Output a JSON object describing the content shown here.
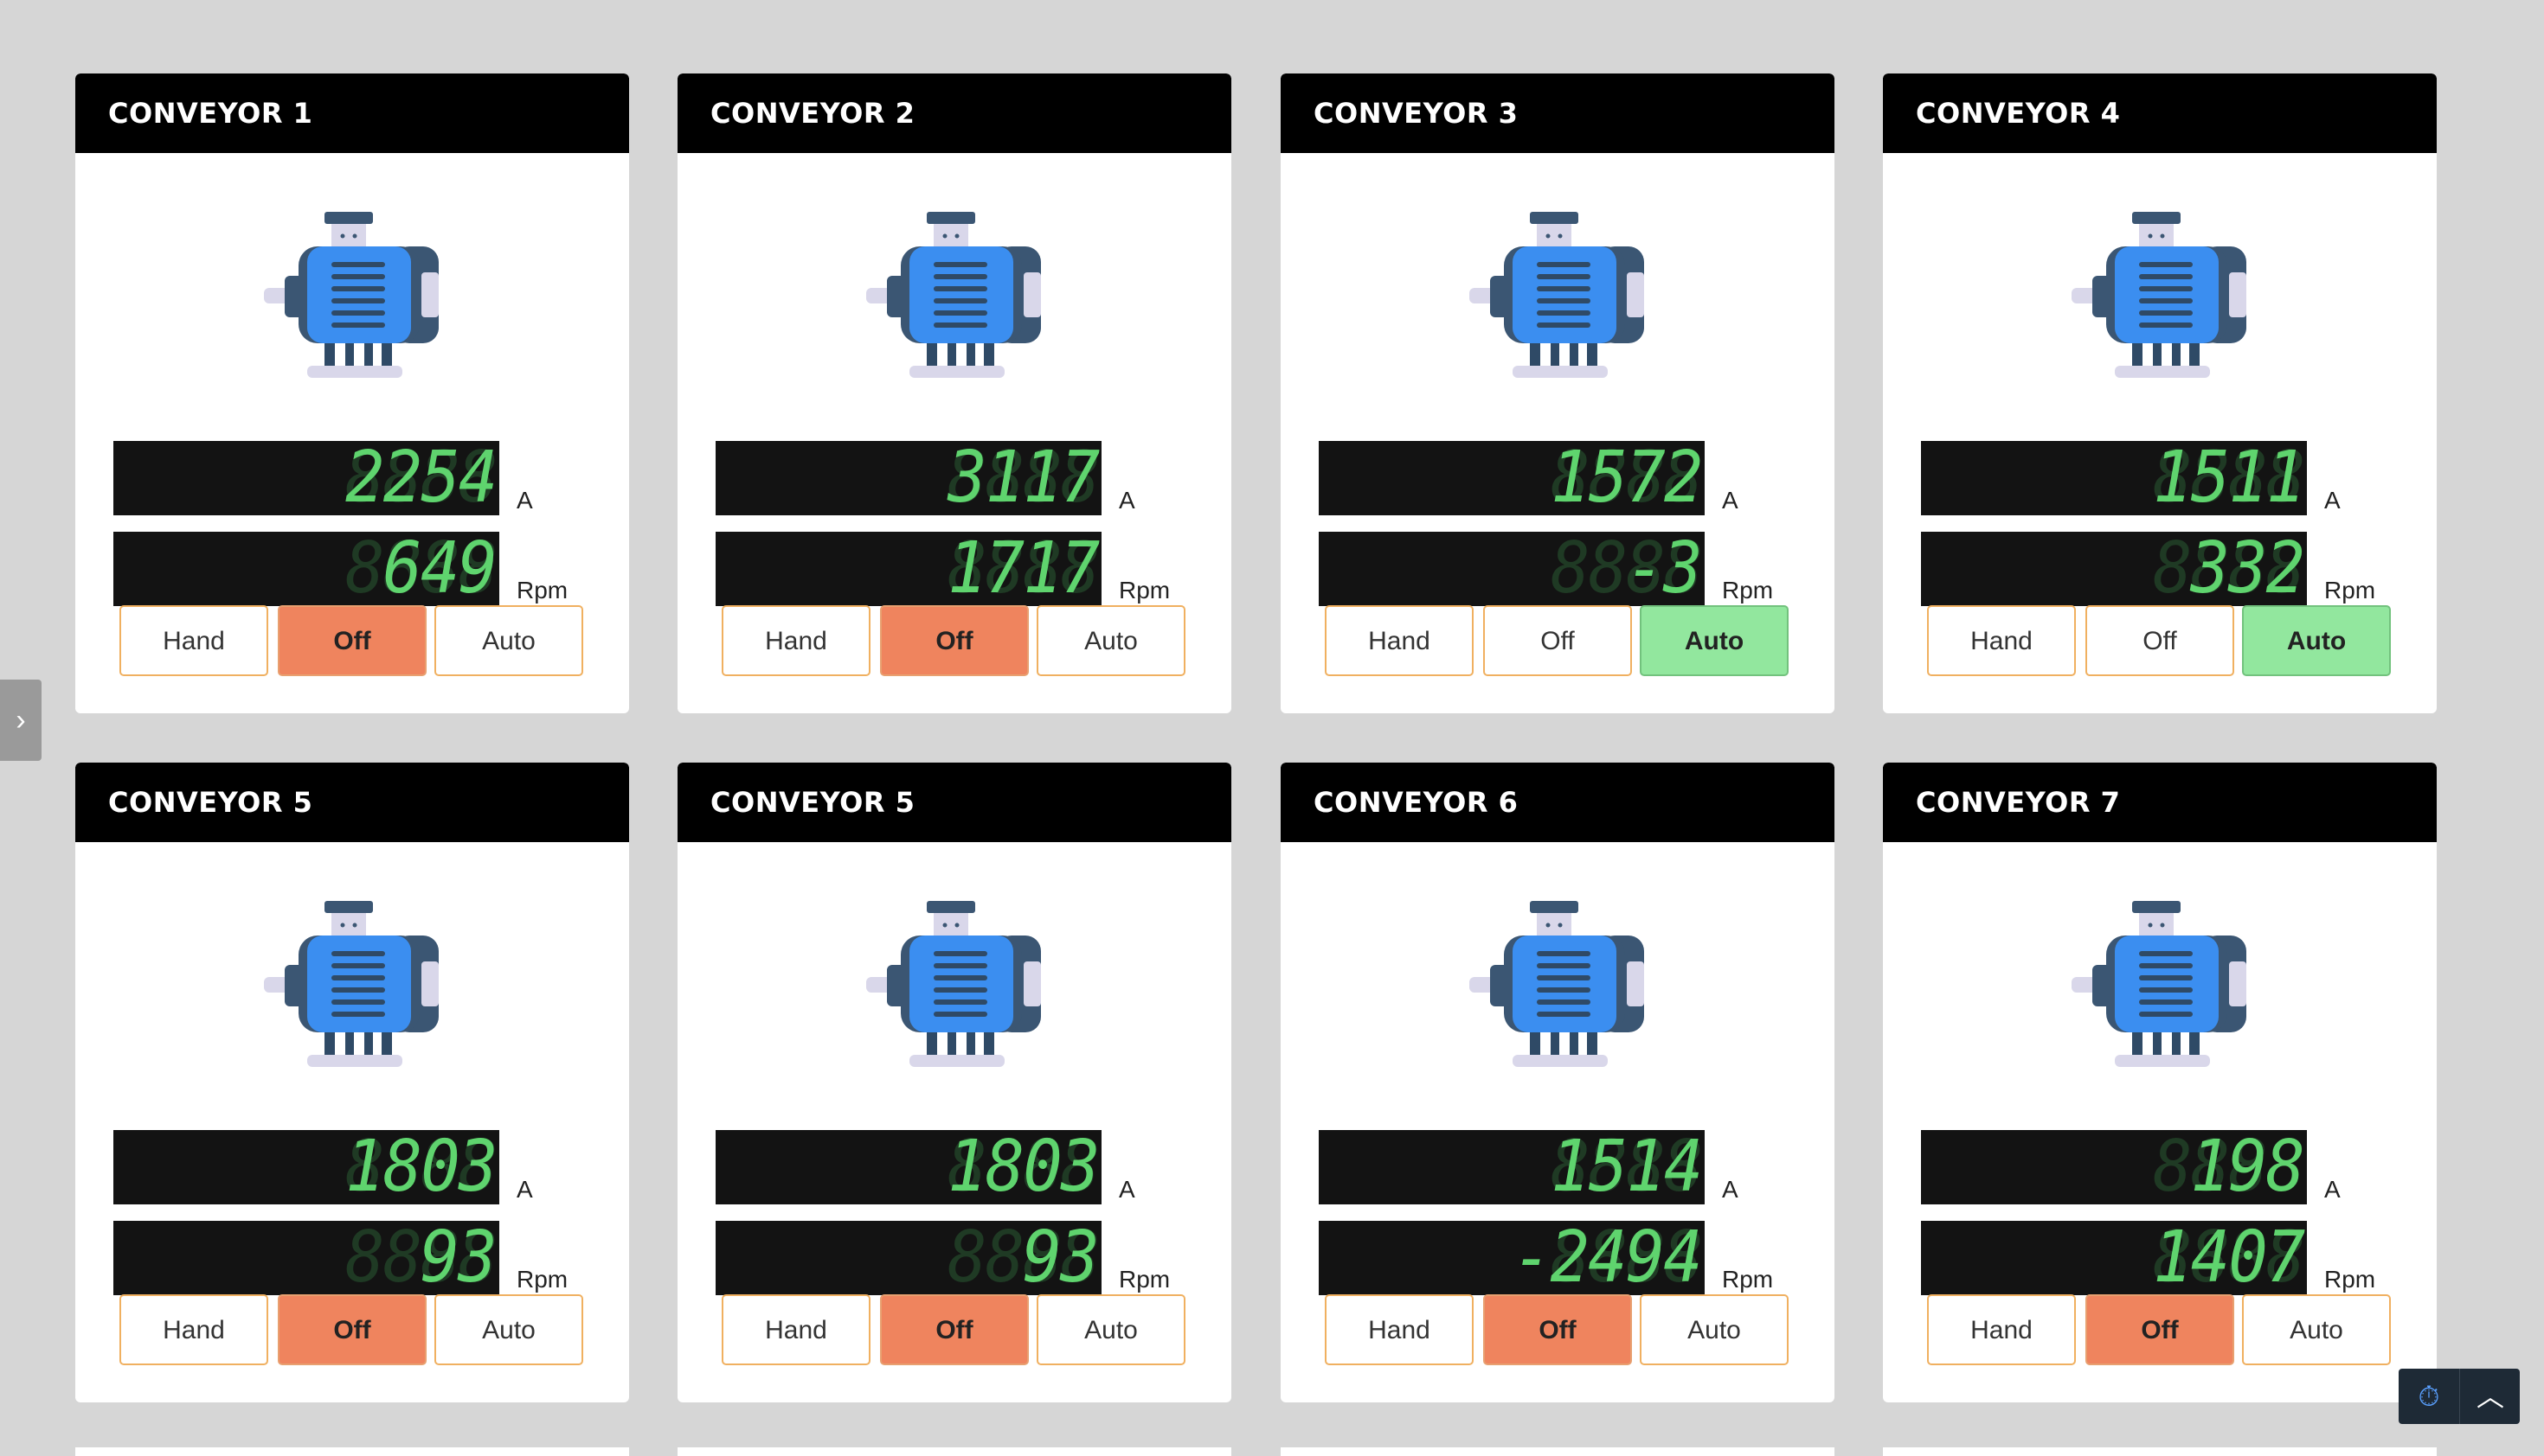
{
  "units": {
    "current": "A",
    "speed": "Rpm"
  },
  "modes": {
    "hand": "Hand",
    "off": "Off",
    "auto": "Auto"
  },
  "icons": {
    "motor": "electric-motor-icon",
    "side_tab": "chevron-right-icon",
    "timer": "stopwatch-icon",
    "scroll_up": "chevron-up-icon"
  },
  "colors": {
    "off_active": "#ef845e",
    "auto_active": "#92e79e",
    "segment_on": "#5fd46e",
    "header": "#000000"
  },
  "side_tab_glyph": "›",
  "corner": {
    "timer_glyph": "⏱",
    "up_glyph": "︿"
  },
  "conveyors": [
    {
      "title": "CONVEYOR 1",
      "current": "2254",
      "speed": "649",
      "mode": "Off"
    },
    {
      "title": "CONVEYOR 2",
      "current": "3117",
      "speed": "1717",
      "mode": "Off"
    },
    {
      "title": "CONVEYOR 3",
      "current": "1572",
      "speed": "-3",
      "mode": "Auto"
    },
    {
      "title": "CONVEYOR 4",
      "current": "1511",
      "speed": "332",
      "mode": "Auto"
    },
    {
      "title": "CONVEYOR 5",
      "current": "1803",
      "speed": "93",
      "mode": "Off"
    },
    {
      "title": "CONVEYOR 5",
      "current": "1803",
      "speed": "93",
      "mode": "Off"
    },
    {
      "title": "CONVEYOR 6",
      "current": "1514",
      "speed": "-2494",
      "mode": "Off"
    },
    {
      "title": "CONVEYOR 7",
      "current": "198",
      "speed": "1407",
      "mode": "Off"
    }
  ]
}
